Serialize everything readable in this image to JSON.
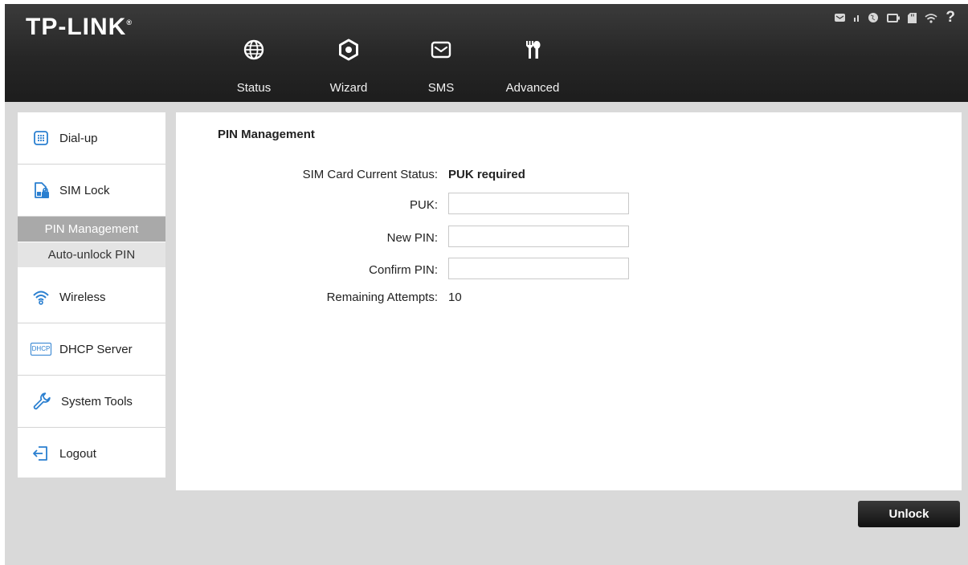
{
  "brand": {
    "logo": "TP-LINK",
    "mark": "®"
  },
  "nav": [
    {
      "label": "Status",
      "icon": "globe-icon"
    },
    {
      "label": "Wizard",
      "icon": "gear-icon"
    },
    {
      "label": "SMS",
      "icon": "envelope-icon"
    },
    {
      "label": "Advanced",
      "icon": "tools-icon",
      "active": true
    }
  ],
  "status_bar": {
    "icons": [
      "message-icon",
      "signal-icon",
      "internet-icon",
      "battery-icon",
      "sd-card-icon",
      "wifi-icon",
      "help-icon"
    ],
    "help_label": "?"
  },
  "sidebar": {
    "items": [
      {
        "label": "Dial-up",
        "icon": "keypad-icon"
      },
      {
        "label": "SIM Lock",
        "icon": "sim-lock-icon"
      },
      {
        "label": "Wireless",
        "icon": "wifi-icon"
      },
      {
        "label": "DHCP Server",
        "icon": "dhcp-icon",
        "icon_text": "DHCP"
      },
      {
        "label": "System Tools",
        "icon": "wrench-icon"
      },
      {
        "label": "Logout",
        "icon": "logout-icon"
      }
    ],
    "sim_lock_sub": [
      {
        "label": "PIN Management",
        "active": true
      },
      {
        "label": "Auto-unlock PIN",
        "active": false
      }
    ]
  },
  "main": {
    "title": "PIN Management",
    "status_label": "SIM Card Current Status:",
    "status_value": "PUK required",
    "puk_label": "PUK:",
    "puk_value": "",
    "new_pin_label": "New PIN:",
    "new_pin_value": "",
    "confirm_pin_label": "Confirm PIN:",
    "confirm_pin_value": "",
    "attempts_label": "Remaining Attempts:",
    "attempts_value": "10"
  },
  "actions": {
    "unlock_label": "Unlock"
  },
  "colors": {
    "header_bg": "#262626",
    "panel_bg": "#ffffff",
    "page_bg": "#d9d9d9",
    "active_sub": "#a9a9a9"
  }
}
